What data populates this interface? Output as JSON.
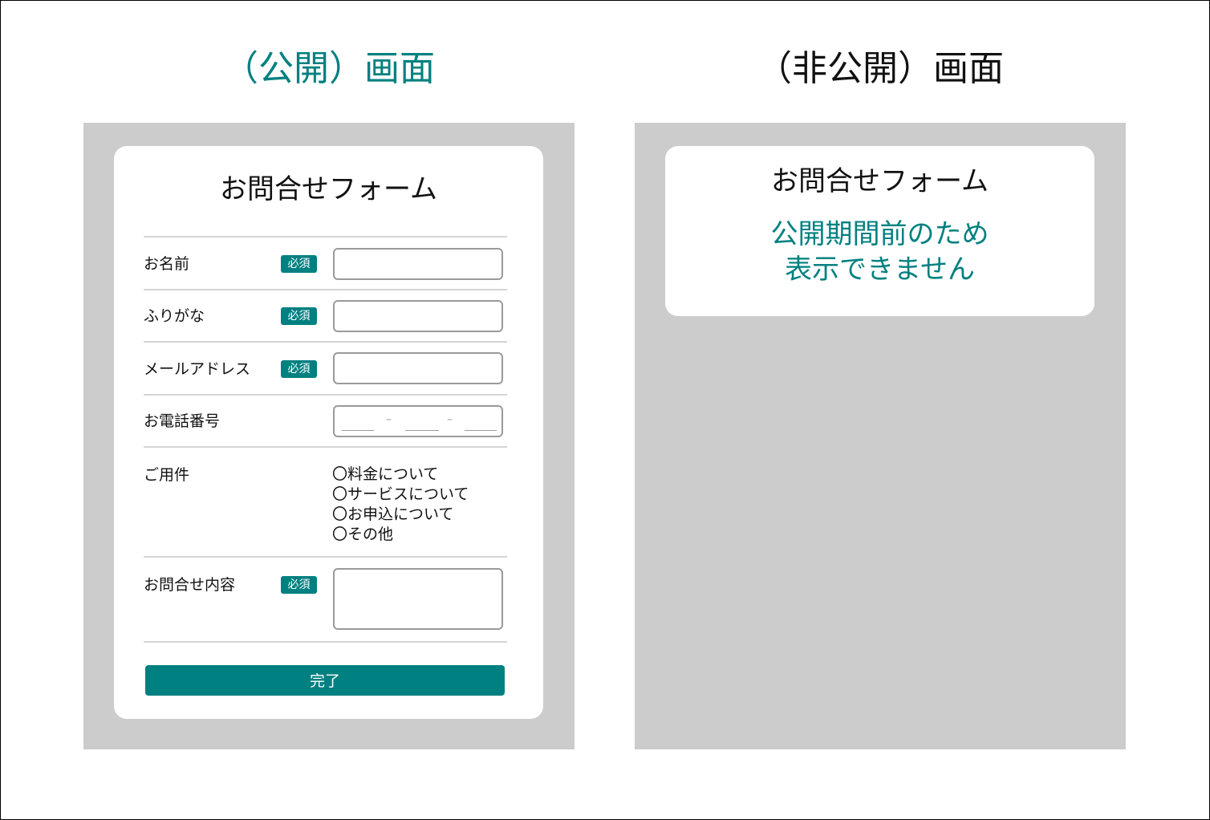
{
  "public_heading": "（公開）画面",
  "private_heading": "（非公開）画面",
  "form": {
    "title": "お問合せフォーム",
    "required_badge": "必須",
    "fields": {
      "name": "お名前",
      "furigana": "ふりがな",
      "email": "メールアドレス",
      "phone": "お電話番号",
      "inquiry_type": "ご用件",
      "message": "お問合せ内容"
    },
    "phone_separator": "–",
    "options": [
      "〇料金について",
      "〇サービスについて",
      "〇お申込について",
      "〇その他"
    ],
    "submit_label": "完了"
  },
  "closed": {
    "title": "お問合せフォーム",
    "message_line1": "公開期間前のため",
    "message_line2": "表示できません"
  },
  "colors": {
    "accent": "#008080",
    "panel_gray": "#cccccc"
  }
}
